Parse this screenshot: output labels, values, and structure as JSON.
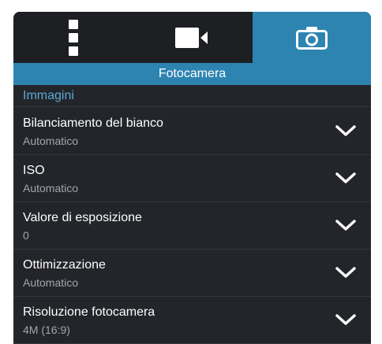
{
  "tabs": [
    {
      "name": "menu-icon"
    },
    {
      "name": "video-camera-icon"
    },
    {
      "name": "camera-icon",
      "active": true
    }
  ],
  "header": {
    "title": "Fotocamera"
  },
  "category": {
    "label": "Immagini"
  },
  "settings": [
    {
      "title": "Bilanciamento del bianco",
      "value": "Automatico"
    },
    {
      "title": "ISO",
      "value": "Automatico"
    },
    {
      "title": "Valore di esposizione",
      "value": "0"
    },
    {
      "title": "Ottimizzazione",
      "value": "Automatico"
    },
    {
      "title": "Risoluzione fotocamera",
      "value": "4M (16:9)"
    }
  ],
  "colors": {
    "accent": "#2e84b1",
    "panel_background": "#23252a",
    "tabbar_background": "#1d1f23",
    "category_text": "#5aa9d6",
    "secondary_text": "#a4a6ab"
  }
}
